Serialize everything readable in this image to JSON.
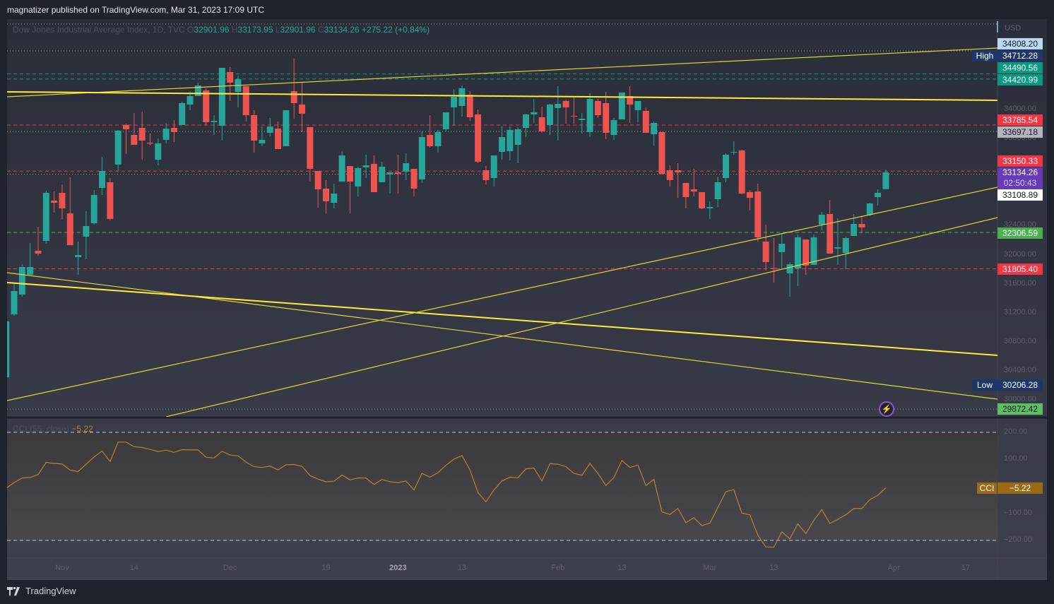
{
  "header": {
    "published": "magnatizer published on TradingView.com, Mar 31, 2023 17:09 UTC"
  },
  "legend": {
    "symbol": "Dow Jones Industrial Average Index, 1D, TVC",
    "o_label": "O",
    "open": "32901.96",
    "h_label": "H",
    "high": "33173.95",
    "l_label": "L",
    "low": "32901.96",
    "c_label": "C",
    "close": "33134.26",
    "change": "+275.22 (+0.84%)"
  },
  "currency": "USD",
  "colors": {
    "up": "#26a69a",
    "down": "#ef5350",
    "trendline": "#ffeb3b",
    "cci": "#b8832a",
    "accent_purple": "#673ab7"
  },
  "price_labels": {
    "p34808": "34808.20",
    "high_tag": "High",
    "high": "34712.28",
    "p34490": "34490.56",
    "p34420": "34420.99",
    "p33785": "33785.54",
    "p33697": "33697.18",
    "p33150": "33150.33",
    "last": "33134.26",
    "countdown": "02:50:43",
    "p33108": "33108.89",
    "p32306": "32306.59",
    "p31805": "31805.40",
    "low_tag": "Low",
    "low": "30206.28",
    "p29872": "29872.42"
  },
  "price_ticks": [
    "34000.00",
    "33600.00",
    "32400.00",
    "32000.00",
    "31600.00",
    "31200.00",
    "30800.00",
    "30400.00",
    "30000.00"
  ],
  "cci": {
    "title": "CCI (55, close)",
    "value": "−5.22",
    "tag": "CCI",
    "ticks": [
      "200.00",
      "100.00",
      "−100.00",
      "−200.00"
    ],
    "bands": [
      200,
      -200
    ]
  },
  "time_ticks": [
    {
      "label": "Nov",
      "date": "2022-11-01"
    },
    {
      "label": "14",
      "date": "2022-11-14"
    },
    {
      "label": "Dec",
      "date": "2022-12-01"
    },
    {
      "label": "19",
      "date": "2022-12-19"
    },
    {
      "label": "2023",
      "date": "2023-01-03",
      "bold": true
    },
    {
      "label": "13",
      "date": "2023-01-13"
    },
    {
      "label": "Feb",
      "date": "2023-02-01"
    },
    {
      "label": "13",
      "date": "2023-02-13"
    },
    {
      "label": "Mar",
      "date": "2023-03-01"
    },
    {
      "label": "13",
      "date": "2023-03-13"
    },
    {
      "label": "Apr",
      "date": "2023-04-03"
    },
    {
      "label": "17",
      "date": "2023-04-17"
    }
  ],
  "footer": {
    "brand": "TradingView"
  },
  "chart_data": {
    "type": "candlestick",
    "symbol": "Dow Jones Industrial Average Index, 1D, TVC",
    "ylim": [
      29700,
      35400
    ],
    "columns": [
      "date",
      "open",
      "high",
      "low",
      "close"
    ],
    "candles": [
      [
        "2022-10-21",
        30310,
        31085,
        30206,
        31082
      ],
      [
        "2022-10-24",
        31178,
        31596,
        31158,
        31499
      ],
      [
        "2022-10-25",
        31450,
        31869,
        31421,
        31830
      ],
      [
        "2022-10-26",
        31723,
        32161,
        31723,
        31830
      ],
      [
        "2022-10-27",
        32054,
        32384,
        31985,
        32015
      ],
      [
        "2022-10-28",
        32190,
        32881,
        32151,
        32852
      ],
      [
        "2022-10-31",
        32745,
        32871,
        32579,
        32715
      ],
      [
        "2022-11-01",
        32852,
        32968,
        32482,
        32638
      ],
      [
        "2022-11-02",
        32569,
        33066,
        32131,
        32131
      ],
      [
        "2022-11-03",
        31966,
        32180,
        31723,
        31995
      ],
      [
        "2022-11-04",
        32248,
        32599,
        31937,
        32394
      ],
      [
        "2022-11-07",
        32433,
        32891,
        32414,
        32822
      ],
      [
        "2022-11-08",
        32920,
        33348,
        32822,
        33153
      ],
      [
        "2022-11-09",
        32998,
        33056,
        32472,
        32492
      ],
      [
        "2022-11-10",
        33241,
        33718,
        33153,
        33708
      ],
      [
        "2022-11-11",
        33786,
        33805,
        33387,
        33728
      ],
      [
        "2022-11-14",
        33650,
        33951,
        33513,
        33513
      ],
      [
        "2022-11-15",
        33747,
        33971,
        33309,
        33572
      ],
      [
        "2022-11-16",
        33543,
        33669,
        33504,
        33530
      ],
      [
        "2022-11-17",
        33309,
        33601,
        33231,
        33533
      ],
      [
        "2022-11-18",
        33582,
        33815,
        33533,
        33737
      ],
      [
        "2022-11-21",
        33747,
        33854,
        33552,
        33689
      ],
      [
        "2022-11-22",
        33786,
        34107,
        33786,
        34088
      ],
      [
        "2022-11-23",
        34068,
        34243,
        33990,
        34185
      ],
      [
        "2022-11-25",
        34185,
        34370,
        34185,
        34331
      ],
      [
        "2022-11-28",
        34263,
        34292,
        33786,
        33825
      ],
      [
        "2022-11-29",
        33825,
        33922,
        33650,
        33844
      ],
      [
        "2022-11-30",
        33776,
        34574,
        33572,
        34574
      ],
      [
        "2022-12-01",
        34516,
        34584,
        34117,
        34370
      ],
      [
        "2022-12-02",
        34243,
        34467,
        34029,
        34418
      ],
      [
        "2022-12-05",
        34321,
        34321,
        33835,
        33922
      ],
      [
        "2022-12-06",
        33922,
        33990,
        33406,
        33572
      ],
      [
        "2022-12-07",
        33533,
        33766,
        33494,
        33582
      ],
      [
        "2022-12-08",
        33679,
        33883,
        33630,
        33766
      ],
      [
        "2022-12-09",
        33737,
        33835,
        33455,
        33455
      ],
      [
        "2022-12-12",
        33494,
        33990,
        33494,
        33990
      ],
      [
        "2022-12-13",
        34253,
        34701,
        33873,
        34088
      ],
      [
        "2022-12-14",
        34068,
        34380,
        33689,
        33942
      ],
      [
        "2022-12-15",
        33757,
        33757,
        33007,
        33183
      ],
      [
        "2022-12-16",
        33153,
        33153,
        32647,
        32900
      ],
      [
        "2022-12-19",
        32910,
        33027,
        32569,
        32735
      ],
      [
        "2022-12-20",
        32715,
        32978,
        32638,
        32842
      ],
      [
        "2022-12-21",
        33007,
        33426,
        33007,
        33367
      ],
      [
        "2022-12-22",
        33221,
        33221,
        32569,
        33007
      ],
      [
        "2022-12-23",
        32939,
        33212,
        32803,
        33192
      ],
      [
        "2022-12-27",
        33202,
        33377,
        33056,
        33231
      ],
      [
        "2022-12-28",
        33251,
        33367,
        32861,
        32861
      ],
      [
        "2022-12-29",
        32998,
        33280,
        32998,
        33212
      ],
      [
        "2022-12-30",
        33105,
        33134,
        32842,
        33134
      ],
      [
        "2023-01-03",
        33134,
        33377,
        32842,
        33114
      ],
      [
        "2023-01-04",
        33144,
        33397,
        33027,
        33260
      ],
      [
        "2023-01-05",
        33183,
        33183,
        32803,
        32910
      ],
      [
        "2023-01-06",
        33037,
        33698,
        32988,
        33620
      ],
      [
        "2023-01-09",
        33650,
        33922,
        33474,
        33494
      ],
      [
        "2023-01-10",
        33494,
        33718,
        33406,
        33689
      ],
      [
        "2023-01-11",
        33728,
        33961,
        33698,
        33961
      ],
      [
        "2023-01-12",
        34029,
        34282,
        33776,
        34175
      ],
      [
        "2023-01-13",
        34049,
        34331,
        33903,
        34292
      ],
      [
        "2023-01-17",
        34204,
        34253,
        33844,
        33893
      ],
      [
        "2023-01-18",
        33932,
        34000,
        33260,
        33280
      ],
      [
        "2023-01-19",
        33163,
        33221,
        32968,
        33027
      ],
      [
        "2023-01-20",
        33056,
        33367,
        32939,
        33367
      ],
      [
        "2023-01-23",
        33416,
        33766,
        33309,
        33620
      ],
      [
        "2023-01-24",
        33426,
        33766,
        33299,
        33718
      ],
      [
        "2023-01-25",
        33513,
        33757,
        33260,
        33728
      ],
      [
        "2023-01-26",
        33747,
        33942,
        33620,
        33932
      ],
      [
        "2023-01-27",
        33932,
        34146,
        33815,
        33961
      ],
      [
        "2023-01-30",
        33893,
        34039,
        33679,
        33698
      ],
      [
        "2023-01-31",
        33786,
        34078,
        33650,
        34068
      ],
      [
        "2023-02-01",
        34019,
        34321,
        33572,
        34078
      ],
      [
        "2023-02-02",
        34117,
        34136,
        33805,
        34029
      ],
      [
        "2023-02-03",
        33912,
        34165,
        33805,
        33907
      ],
      [
        "2023-02-06",
        33854,
        33951,
        33669,
        33873
      ],
      [
        "2023-02-07",
        33689,
        34224,
        33620,
        34146
      ],
      [
        "2023-02-08",
        34117,
        34146,
        33883,
        33922
      ],
      [
        "2023-02-09",
        34088,
        34243,
        33591,
        33679
      ],
      [
        "2023-02-10",
        33650,
        33883,
        33582,
        33854
      ],
      [
        "2023-02-13",
        33864,
        34234,
        33864,
        34234
      ],
      [
        "2023-02-14",
        34185,
        34321,
        33815,
        34068
      ],
      [
        "2023-02-15",
        33990,
        34117,
        33825,
        34117
      ],
      [
        "2023-02-16",
        33981,
        34029,
        33679,
        33679
      ],
      [
        "2023-02-17",
        33659,
        33835,
        33504,
        33815
      ],
      [
        "2023-02-21",
        33689,
        33689,
        33105,
        33114
      ],
      [
        "2023-02-22",
        33163,
        33231,
        32939,
        33027
      ],
      [
        "2023-02-23",
        33163,
        33260,
        32783,
        33134
      ],
      [
        "2023-02-24",
        32988,
        32988,
        32638,
        32793
      ],
      [
        "2023-02-27",
        32900,
        33183,
        32803,
        32871
      ],
      [
        "2023-02-28",
        32861,
        32861,
        32628,
        32638
      ],
      [
        "2023-03-01",
        32638,
        32735,
        32492,
        32657
      ],
      [
        "2023-03-02",
        32764,
        33075,
        32657,
        32998
      ],
      [
        "2023-03-03",
        33056,
        33397,
        32998,
        33377
      ],
      [
        "2023-03-06",
        33411,
        33562,
        33377,
        33416
      ],
      [
        "2023-03-07",
        33436,
        33446,
        32832,
        32842
      ],
      [
        "2023-03-08",
        32861,
        32891,
        32608,
        32783
      ],
      [
        "2023-03-09",
        32871,
        32978,
        32180,
        32239
      ],
      [
        "2023-03-10",
        32180,
        32414,
        31781,
        31898
      ],
      [
        "2023-03-13",
        31815,
        32229,
        31616,
        31805
      ],
      [
        "2023-03-14",
        32034,
        32297,
        31810,
        32151
      ],
      [
        "2023-03-15",
        31742,
        31898,
        31421,
        31869
      ],
      [
        "2023-03-16",
        31810,
        32277,
        31567,
        32239
      ],
      [
        "2023-03-17",
        32209,
        32209,
        31723,
        31849
      ],
      [
        "2023-03-20",
        31859,
        32277,
        31859,
        32239
      ],
      [
        "2023-03-21",
        32414,
        32589,
        32336,
        32550
      ],
      [
        "2023-03-22",
        32560,
        32754,
        32015,
        32015
      ],
      [
        "2023-03-23",
        32083,
        32501,
        31859,
        32102
      ],
      [
        "2023-03-24",
        32024,
        32248,
        31801,
        32229
      ],
      [
        "2023-03-27",
        32258,
        32560,
        32258,
        32423
      ],
      [
        "2023-03-28",
        32423,
        32540,
        32297,
        32375
      ],
      [
        "2023-03-29",
        32550,
        32715,
        32530,
        32706
      ],
      [
        "2023-03-30",
        32793,
        32900,
        32676,
        32852
      ],
      [
        "2023-03-31",
        32901.96,
        33173.95,
        32901.96,
        33134.26
      ]
    ],
    "horizontal_lines": [
      {
        "price": 34808.2,
        "style": "dotted",
        "color": "#9598a1"
      },
      {
        "price": 34490.56,
        "style": "dashed",
        "color": "#089981"
      },
      {
        "price": 34420.99,
        "style": "dashed",
        "color": "#089981"
      },
      {
        "price": 33785.54,
        "style": "dashed",
        "color": "#f23645"
      },
      {
        "price": 33697.18,
        "style": "dotted",
        "color": "#9598a1"
      },
      {
        "price": 33150.33,
        "style": "dashed",
        "color": "#f23645"
      },
      {
        "price": 33108.89,
        "style": "dotted",
        "color": "#9598a1"
      },
      {
        "price": 32306.59,
        "style": "dashed",
        "color": "#4caf50"
      },
      {
        "price": 31805.4,
        "style": "dashed",
        "color": "#f23645"
      },
      {
        "price": 29872.42,
        "style": "dotted",
        "color": "#4caf50"
      }
    ],
    "cci_values": [
      -7,
      14,
      31,
      33,
      44,
      89,
      85,
      83,
      60,
      55,
      82,
      109,
      131,
      92,
      164,
      164,
      147,
      144,
      137,
      129,
      134,
      126,
      136,
      135,
      135,
      108,
      105,
      130,
      116,
      113,
      90,
      73,
      70,
      75,
      61,
      80,
      81,
      74,
      40,
      27,
      17,
      19,
      42,
      24,
      31,
      31,
      7,
      26,
      17,
      14,
      20,
      -13,
      48,
      34,
      51,
      78,
      101,
      114,
      61,
      -23,
      -57,
      -13,
      20,
      34,
      32,
      65,
      68,
      20,
      84,
      82,
      73,
      48,
      41,
      85,
      48,
      3,
      33,
      96,
      70,
      79,
      3,
      26,
      -94,
      -104,
      -82,
      -134,
      -116,
      -145,
      -136,
      -78,
      -20,
      -12,
      -99,
      -105,
      -181,
      -224,
      -225,
      -168,
      -194,
      -139,
      -175,
      -126,
      -86,
      -137,
      -122,
      -105,
      -82,
      -82,
      -49,
      -33,
      -5.22
    ]
  }
}
